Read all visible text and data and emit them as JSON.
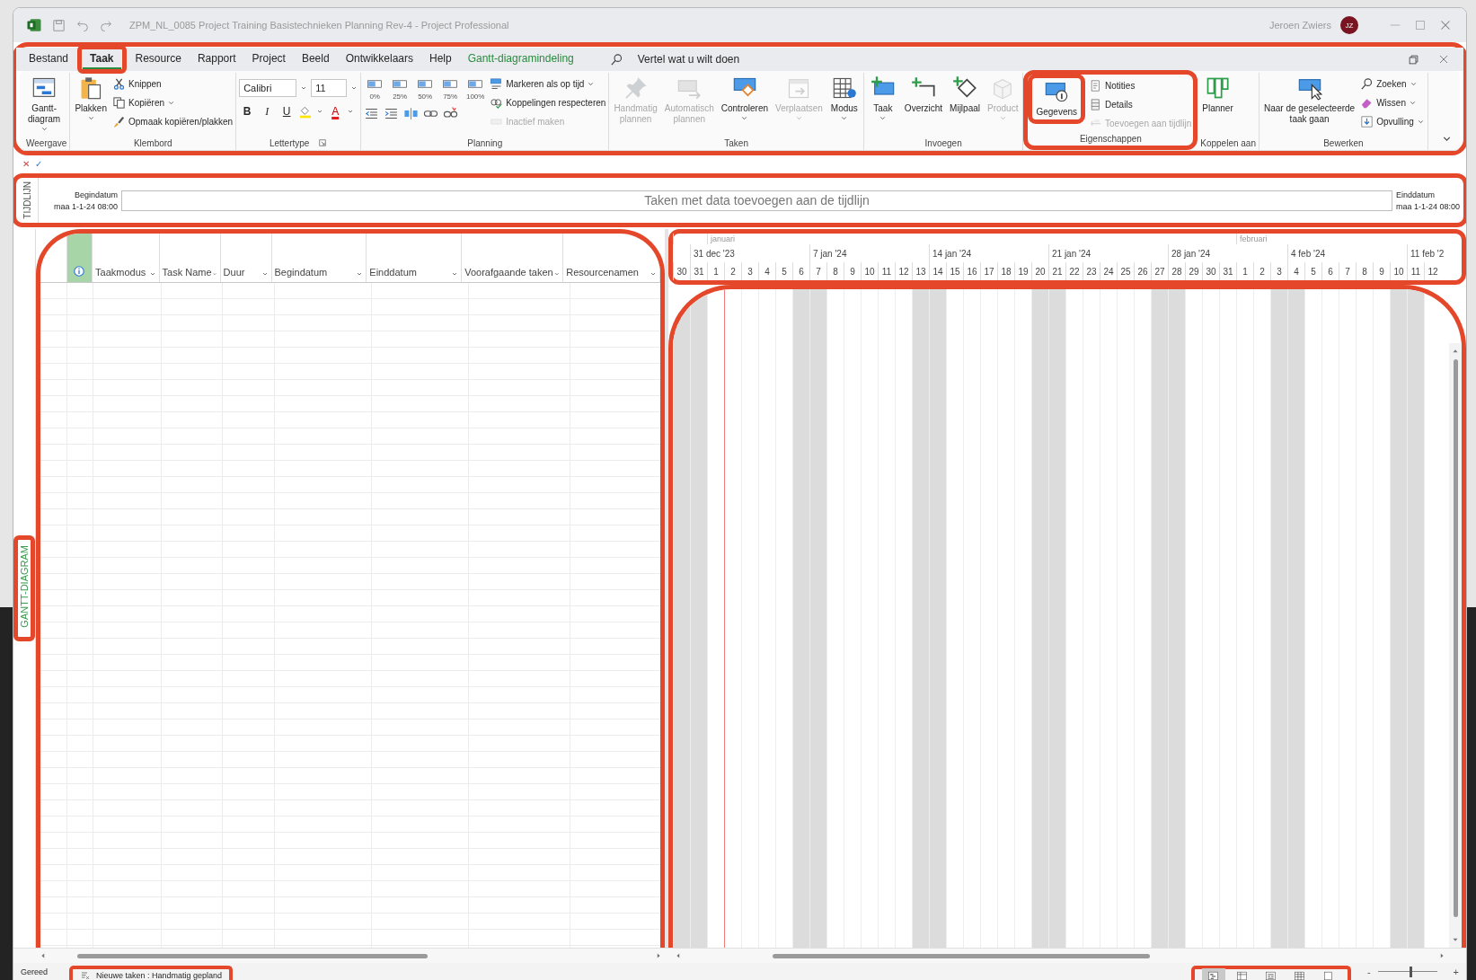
{
  "window": {
    "title": "ZPM_NL_0085 Project Training Basistechnieken Planning Rev-4  -  Project Professional",
    "user": "Jeroen Zwiers",
    "avatar_initials": "JZ"
  },
  "menu_tabs": [
    {
      "label": "Bestand",
      "kind": "tab",
      "selected": false
    },
    {
      "label": "Taak",
      "kind": "tab",
      "selected": true
    },
    {
      "label": "Resource",
      "kind": "tab",
      "selected": false
    },
    {
      "label": "Rapport",
      "kind": "tab",
      "selected": false
    },
    {
      "label": "Project",
      "kind": "tab",
      "selected": false
    },
    {
      "label": "Beeld",
      "kind": "tab",
      "selected": false
    },
    {
      "label": "Ontwikkelaars",
      "kind": "tab",
      "selected": false
    },
    {
      "label": "Help",
      "kind": "tab",
      "selected": false
    },
    {
      "label": "Gantt-diagramindeling",
      "kind": "contextual",
      "selected": false
    }
  ],
  "tell_me": {
    "placeholder": "Vertel wat u wilt doen"
  },
  "ribbon": {
    "groups": [
      {
        "label": "Weergave",
        "launcher": false,
        "items": [
          {
            "kind": "large",
            "lines": [
              "Gantt-",
              "diagram"
            ],
            "dropdown": true,
            "disabled": false
          }
        ]
      },
      {
        "label": "Klembord",
        "launcher": false,
        "items": [
          {
            "kind": "large",
            "lines": [
              "Plakken"
            ],
            "dropdown": true,
            "disabled": false
          },
          {
            "kind": "stack",
            "buttons": [
              {
                "label": "Knippen",
                "dropdown": false,
                "disabled": false
              },
              {
                "label": "Kopiëren",
                "dropdown": true,
                "disabled": false
              },
              {
                "label": "Opmaak kopiëren/plakken",
                "dropdown": false,
                "disabled": false
              }
            ]
          }
        ]
      },
      {
        "label": "Lettertype",
        "launcher": true,
        "items": [
          {
            "kind": "font",
            "font": "Calibri",
            "size": "11",
            "bold": "B",
            "italic": "I",
            "underline": "U",
            "font_color": "A"
          }
        ]
      },
      {
        "label": "Planning",
        "launcher": false,
        "items": [
          {
            "kind": "progress",
            "percents": [
              "0%",
              "25%",
              "50%",
              "75%",
              "100%"
            ]
          },
          {
            "kind": "stack",
            "buttons": [
              {
                "label": "Markeren als op tijd",
                "dropdown": true,
                "disabled": false
              },
              {
                "label": "Koppelingen respecteren",
                "dropdown": false,
                "disabled": false
              },
              {
                "label": "Inactief maken",
                "dropdown": false,
                "disabled": true
              }
            ]
          }
        ]
      },
      {
        "label": "Taken",
        "launcher": false,
        "items": [
          {
            "kind": "large",
            "lines": [
              "Handmatig",
              "plannen"
            ],
            "dropdown": false,
            "disabled": true
          },
          {
            "kind": "large",
            "lines": [
              "Automatisch",
              "plannen"
            ],
            "dropdown": false,
            "disabled": true
          },
          {
            "kind": "large",
            "lines": [
              "Controleren"
            ],
            "dropdown": true,
            "disabled": false
          },
          {
            "kind": "large",
            "lines": [
              "Verplaatsen"
            ],
            "dropdown": true,
            "disabled": true
          },
          {
            "kind": "large",
            "lines": [
              "Modus"
            ],
            "dropdown": true,
            "disabled": false
          }
        ]
      },
      {
        "label": "Invoegen",
        "launcher": false,
        "items": [
          {
            "kind": "large",
            "lines": [
              "Taak"
            ],
            "dropdown": true,
            "disabled": false
          },
          {
            "kind": "large",
            "lines": [
              "Overzicht"
            ],
            "dropdown": false,
            "disabled": false
          },
          {
            "kind": "large",
            "lines": [
              "Mijlpaal"
            ],
            "dropdown": false,
            "disabled": false
          },
          {
            "kind": "large",
            "lines": [
              "Product"
            ],
            "dropdown": true,
            "disabled": true
          }
        ]
      },
      {
        "label": "Eigenschappen",
        "launcher": false,
        "items": [
          {
            "kind": "large",
            "lines": [
              "Gegevens"
            ],
            "dropdown": false,
            "disabled": false
          },
          {
            "kind": "stack",
            "buttons": [
              {
                "label": "Notities",
                "dropdown": false,
                "disabled": false
              },
              {
                "label": "Details",
                "dropdown": false,
                "disabled": false
              },
              {
                "label": "Toevoegen aan tijdlijn",
                "dropdown": false,
                "disabled": true
              }
            ]
          }
        ]
      },
      {
        "label": "Koppelen aan",
        "launcher": false,
        "items": [
          {
            "kind": "large",
            "lines": [
              "Planner"
            ],
            "dropdown": false,
            "disabled": false
          }
        ]
      },
      {
        "label": "Bewerken",
        "launcher": false,
        "items": [
          {
            "kind": "large",
            "lines": [
              "Naar de geselecteerde",
              "taak gaan"
            ],
            "dropdown": false,
            "disabled": false
          },
          {
            "kind": "stack",
            "buttons": [
              {
                "label": "Zoeken",
                "dropdown": true,
                "disabled": false
              },
              {
                "label": "Wissen",
                "dropdown": true,
                "disabled": false
              },
              {
                "label": "Opvulling",
                "dropdown": true,
                "disabled": false
              }
            ]
          }
        ]
      }
    ]
  },
  "entry_bar": {
    "cancel": "✕",
    "confirm": "✓"
  },
  "timeline": {
    "side_label": "TIJDLIJN",
    "start_label": "Begindatum",
    "start_date": "maa 1-1-24 08:00",
    "message": "Taken met data toevoegen aan de tijdlijn",
    "end_label": "Einddatum",
    "end_date": "maa 1-1-24 08:00"
  },
  "gantt": {
    "side_label": "GANTT-DIAGRAM",
    "columns": [
      "Taakmodus",
      "Task Name",
      "Duur",
      "Begindatum",
      "Einddatum",
      "Voorafgaande taken",
      "Resourcenamen"
    ]
  },
  "chart": {
    "days": [
      {
        "day": "30",
        "weekend": true
      },
      {
        "day": "31",
        "weekend": true,
        "week_label": "31 dec '23"
      },
      {
        "day": "1",
        "weekend": false,
        "month": "januari"
      },
      {
        "day": "2",
        "weekend": false
      },
      {
        "day": "3",
        "weekend": false
      },
      {
        "day": "4",
        "weekend": false
      },
      {
        "day": "5",
        "weekend": false
      },
      {
        "day": "6",
        "weekend": true
      },
      {
        "day": "7",
        "weekend": true,
        "week_label": "7 jan '24"
      },
      {
        "day": "8",
        "weekend": false
      },
      {
        "day": "9",
        "weekend": false
      },
      {
        "day": "10",
        "weekend": false
      },
      {
        "day": "11",
        "weekend": false
      },
      {
        "day": "12",
        "weekend": false
      },
      {
        "day": "13",
        "weekend": true
      },
      {
        "day": "14",
        "weekend": true,
        "week_label": "14 jan '24"
      },
      {
        "day": "15",
        "weekend": false
      },
      {
        "day": "16",
        "weekend": false
      },
      {
        "day": "17",
        "weekend": false
      },
      {
        "day": "18",
        "weekend": false
      },
      {
        "day": "19",
        "weekend": false
      },
      {
        "day": "20",
        "weekend": true
      },
      {
        "day": "21",
        "weekend": true,
        "week_label": "21 jan '24"
      },
      {
        "day": "22",
        "weekend": false
      },
      {
        "day": "23",
        "weekend": false
      },
      {
        "day": "24",
        "weekend": false
      },
      {
        "day": "25",
        "weekend": false
      },
      {
        "day": "26",
        "weekend": false
      },
      {
        "day": "27",
        "weekend": true
      },
      {
        "day": "28",
        "weekend": true,
        "week_label": "28 jan '24"
      },
      {
        "day": "29",
        "weekend": false
      },
      {
        "day": "30",
        "weekend": false
      },
      {
        "day": "31",
        "weekend": false
      },
      {
        "day": "1",
        "weekend": false,
        "month": "februari"
      },
      {
        "day": "2",
        "weekend": false
      },
      {
        "day": "3",
        "weekend": true
      },
      {
        "day": "4",
        "weekend": true,
        "week_label": "4 feb '24"
      },
      {
        "day": "5",
        "weekend": false
      },
      {
        "day": "6",
        "weekend": false
      },
      {
        "day": "7",
        "weekend": false
      },
      {
        "day": "8",
        "weekend": false
      },
      {
        "day": "9",
        "weekend": false
      },
      {
        "day": "10",
        "weekend": true
      },
      {
        "day": "11",
        "weekend": true,
        "week_label": "11 feb '2"
      },
      {
        "day": "12",
        "weekend": false
      }
    ]
  },
  "status_bar": {
    "ready": "Gereed",
    "new_tasks": "Nieuwe taken : Handmatig gepland",
    "views": [
      {
        "selected": true
      },
      {
        "selected": false
      },
      {
        "selected": false
      },
      {
        "selected": false
      },
      {
        "selected": false
      }
    ],
    "zoom_minus": "-",
    "zoom_plus": "+",
    "zoom": {
      "level": 0.55
    }
  }
}
